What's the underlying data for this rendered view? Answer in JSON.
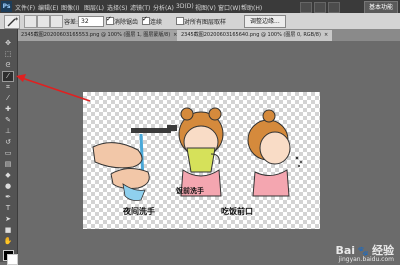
{
  "menubar": {
    "logo": "Ps",
    "items": [
      "文件(F)",
      "编辑(E)",
      "图像(I)",
      "图层(L)",
      "选择(S)",
      "滤镜(T)",
      "分析(A)",
      "3D(D)",
      "视图(V)",
      "窗口(W)",
      "帮助(H)"
    ],
    "workspace": "基本功能"
  },
  "options": {
    "feather_label": "容差:",
    "feather_value": "32",
    "antialias_label": "消除锯齿",
    "contiguous_label": "连续",
    "sample_all_label": "对所有图层取样",
    "refine_edge_label": "调整边缘..."
  },
  "tabs": [
    {
      "label": "2345截图20200603165553.png @ 100% (图层 1, 图层蒙版/8)",
      "active": false
    },
    {
      "label": "2345截图20200603165640.png @ 100% (图层 0, RGB/8)",
      "active": true
    }
  ],
  "canvas": {
    "caption_left": "夜间洗手",
    "caption_mid": "饭前洗手",
    "caption_right": "吃饭前口"
  },
  "watermark": {
    "brand": "Bai",
    "brand2": "经验",
    "url": "jingyan.baidu.com"
  },
  "colors": {
    "annotation_arrow": "#e02020",
    "active_tab": "#c8c8c8"
  }
}
